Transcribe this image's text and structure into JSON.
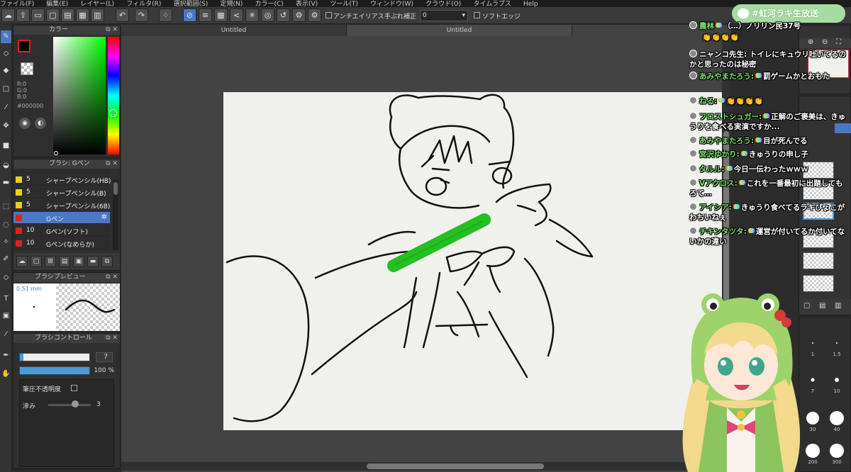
{
  "menubar": {
    "items": [
      "ファイル(F)",
      "編集(E)",
      "レイヤー(L)",
      "フィルタ(R)",
      "選択範囲(S)",
      "定規(N)",
      "カラー(C)",
      "表示(V)",
      "ツール(T)",
      "ウィンドウ(W)",
      "クラウド(O)",
      "タイムラプス",
      "Help"
    ]
  },
  "toolbar": {
    "antialias_label": "アンチエイリアス",
    "stabilizer_label": "手ぶれ補正",
    "stabilizer_value": "0",
    "soft_edge_label": "ソフトエッジ"
  },
  "color_panel": {
    "title": "カラー",
    "r": "R:0",
    "g": "G:0",
    "b": "B:0",
    "hex": "#000000"
  },
  "brush_panel": {
    "title": "ブラシ: Gペン",
    "items": [
      {
        "size": "5",
        "name": "シャープペンシル(HB)",
        "color": "#e8d21a"
      },
      {
        "size": "5",
        "name": "シャープペンシル(B)",
        "color": "#e8d21a"
      },
      {
        "size": "5",
        "name": "シャープペンシル(6B)",
        "color": "#e8d21a"
      },
      {
        "size": "",
        "name": "Gペン",
        "color": "#e02020"
      },
      {
        "size": "10",
        "name": "Gペン(ソフト)",
        "color": "#e02020"
      },
      {
        "size": "10",
        "name": "Gペン(なめらか)",
        "color": "#e02020"
      }
    ]
  },
  "preview_panel": {
    "title": "ブラシプレビュー",
    "size_text": "0.51 mm"
  },
  "control_panel": {
    "title": "ブラシコントロール",
    "size_value": "7",
    "opacity_value": "100 %",
    "pressure_label": "筆圧不透明度",
    "blur_label": "滲み",
    "blur_value": "3",
    "size_fraction": 0.05,
    "opacity_fraction": 1.0
  },
  "document": {
    "tabs": [
      "Untitled",
      "Untitled"
    ]
  },
  "right_panel": {
    "brush_sizes": [
      "1",
      "1.5",
      "7",
      "10",
      "30",
      "40",
      "200",
      "300"
    ]
  },
  "stream": {
    "title": "#虹河ラキ生放送",
    "chat": [
      {
        "author": "農林",
        "text": "（…）ノリリン民37号"
      },
      {
        "author": "",
        "text": "👏👏👏👏"
      },
      {
        "author": "ニャンコ先生:",
        "text": "トイレにキュウリ吐いてるのかと思ったのは秘密"
      },
      {
        "author": "あみやまたろう:",
        "text": "罰ゲームかとおもた"
      },
      {
        "author": "ねる:",
        "text": "👏👏👏👏"
      },
      {
        "author": "フロストシュガー:",
        "text": "正解のご褒美は、きゅうりを食べる実演ですか..."
      },
      {
        "author": "あみやまたろう:",
        "text": "目が死んでる"
      },
      {
        "author": "宮沢ゆかり:",
        "text": "きゅうりの申し子"
      },
      {
        "author": "タルル:",
        "text": "今日一伝わったｗｗｗ"
      },
      {
        "author": "Vアクロス:",
        "text": "これを一番最初に出題してもろて…"
      },
      {
        "author": "アイシア:",
        "text": "きゅうり食べてるラキぴょこがわちいねぇ"
      },
      {
        "author": "チキンタツタ:",
        "text": "運営が付いてるか付いてないかの違い"
      }
    ]
  }
}
